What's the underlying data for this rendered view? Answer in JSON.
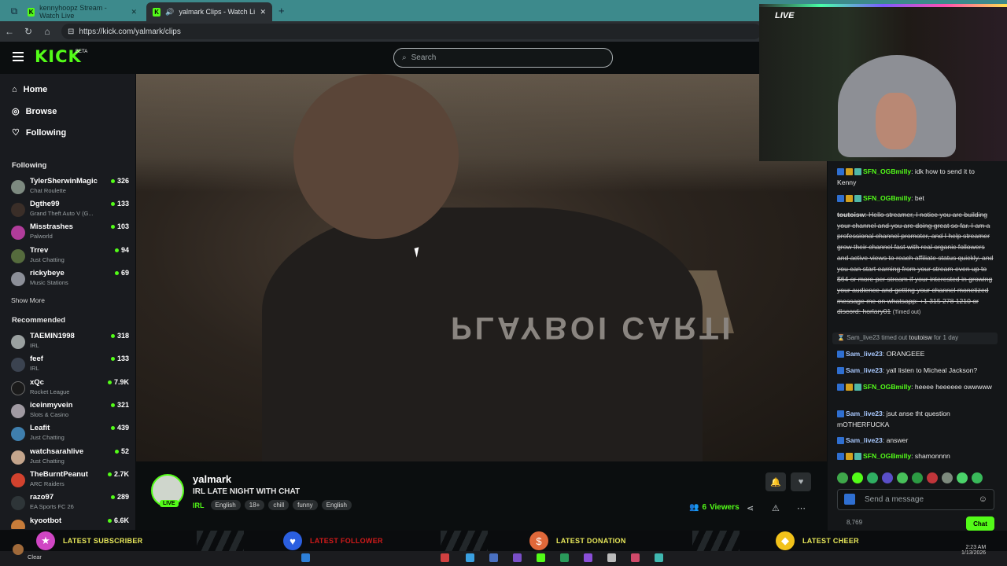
{
  "browser": {
    "tabs": [
      {
        "label": "kennyhoopz Stream - Watch Live"
      },
      {
        "label": "yalmark Clips - Watch Live on"
      }
    ],
    "new_tab": "+",
    "url": "https://kick.com/yalmark/clips"
  },
  "kick": {
    "logo": "KICK",
    "logo_badge": "BETA",
    "search_placeholder": "Search"
  },
  "sidebar": {
    "nav": [
      {
        "label": "Home",
        "icon": "home-icon"
      },
      {
        "label": "Browse",
        "icon": "compass-icon"
      },
      {
        "label": "Following",
        "icon": "heart-icon"
      }
    ],
    "following_header": "Following",
    "following": [
      {
        "name": "TylerSherwinMagic",
        "category": "Chat Roulette",
        "viewers": "326"
      },
      {
        "name": "Dgthe99",
        "category": "Grand Theft Auto V (G...",
        "viewers": "133"
      },
      {
        "name": "Misstrashes",
        "category": "Palworld",
        "viewers": "103"
      },
      {
        "name": "Trrev",
        "category": "Just Chatting",
        "viewers": "94"
      },
      {
        "name": "rickybeye",
        "category": "Music Stations",
        "viewers": "69"
      }
    ],
    "show_more": "Show More",
    "recommended_header": "Recommended",
    "recommended": [
      {
        "name": "TAEMIN1998",
        "category": "IRL",
        "viewers": "318"
      },
      {
        "name": "feef",
        "category": "IRL",
        "viewers": "133"
      },
      {
        "name": "xQc",
        "category": "Rocket League",
        "viewers": "7.9K"
      },
      {
        "name": "iceinmyvein",
        "category": "Slots & Casino",
        "viewers": "321"
      },
      {
        "name": "Leafit",
        "category": "Just Chatting",
        "viewers": "439"
      },
      {
        "name": "watchsarahlive",
        "category": "Just Chatting",
        "viewers": "52"
      },
      {
        "name": "TheBurntPeanut",
        "category": "ARC Raiders",
        "viewers": "2.7K"
      },
      {
        "name": "razo97",
        "category": "EA Sports FC 26",
        "viewers": "289"
      },
      {
        "name": "kyootbot",
        "category": "",
        "viewers": "6.6K"
      }
    ]
  },
  "video": {
    "shirt_text": "PLAYBOI CARTI"
  },
  "stream": {
    "channel": "yalmark",
    "live_badge": "LIVE",
    "title": "IRL LATE NIGHT WITH CHAT",
    "category": "IRL",
    "tags": [
      "English",
      "18+",
      "chill",
      "funny",
      "English"
    ],
    "viewers_count": "6",
    "viewers_label": "Viewers"
  },
  "webcam": {
    "live_label": "LIVE"
  },
  "chat": {
    "messages": [
      {
        "user": "SFN_OGBmilly",
        "text": ": idk how to send it to Kenny"
      },
      {
        "user": "SFN_OGBmilly",
        "text": ": bet"
      },
      {
        "user": "toutoisw",
        "text": ": Hello streamer, I notice you are building your channel and you are doing great so far. I am a professional channel promoter, and I help streamer grow their channel fast with real organic followers and active views to reach affiliate status quickly. and you can start earning from your stream even up to $64 or more per stream if your interested in growing your audience and getting your channel monetized message me on whatsapp: +1 315 278 1210 or discord: horlary01",
        "note": "(Timed out)"
      },
      {
        "user": "Sam_live23",
        "text": ": ORANGEEE"
      },
      {
        "user": "Sam_live23",
        "text": ": yall listen to Micheal Jackson?"
      },
      {
        "user": "SFN_OGBmilly",
        "text": ": heeee heeeeee owwwww"
      },
      {
        "user": "Sam_live23",
        "text": ": jsut anse tht question mOTHERFUCKA"
      },
      {
        "user": "Sam_live23",
        "text": ": answer"
      },
      {
        "user": "SFN_OGBmilly",
        "text": ": shamonnnn"
      }
    ],
    "mod_action": {
      "mod": "Sam_live23",
      "action": "timed out",
      "target": "toutoisw",
      "duration": "for 1 day"
    },
    "input_placeholder": "Send a message",
    "count": "8,769",
    "send_label": "Chat"
  },
  "overlay": {
    "latest_subscriber": "LATEST SUBSCRIBER",
    "latest_follower": "LATEST FOLLOWER",
    "latest_donation": "LATEST DONATION",
    "latest_cheer": "LATEST CHEER"
  },
  "taskbar": {
    "weather": "Clear",
    "time": "2:23 AM",
    "date": "1/13/2026"
  }
}
